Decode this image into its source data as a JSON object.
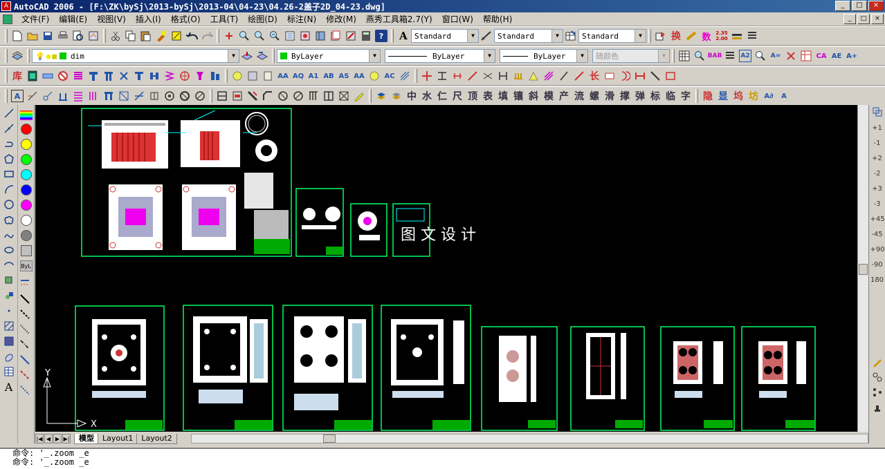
{
  "window": {
    "title": "AutoCAD 2006 - [F:\\ZK\\bySj\\2013-bySj\\2013-04\\04-23\\04.26-2盖子2D_04-23.dwg]",
    "min": "_",
    "max": "□",
    "close": "×"
  },
  "menu": [
    "文件(F)",
    "编辑(E)",
    "视图(V)",
    "插入(I)",
    "格式(O)",
    "工具(T)",
    "绘图(D)",
    "标注(N)",
    "修改(M)",
    "燕秀工具箱2.7(Y)",
    "窗口(W)",
    "帮助(H)"
  ],
  "styles": {
    "text_style": "Standard",
    "dim_style": "Standard",
    "table_style": "Standard"
  },
  "layer": {
    "current": "dim",
    "color": "#00cc00"
  },
  "properties": {
    "color": "ByLayer",
    "linetype": "ByLayer",
    "lineweight": "ByLayer",
    "plotstyle": "随颜色"
  },
  "cjk_tools": [
    "中",
    "水",
    "仁",
    "尺",
    "顶",
    "表",
    "填",
    "镶",
    "斜",
    "模",
    "产",
    "流",
    "螺",
    "滑",
    "撑",
    "弹",
    "标",
    "临",
    "字"
  ],
  "cjk_tools2": [
    "隐",
    "显",
    "坞",
    "坊"
  ],
  "tb3_text": [
    "库",
    "长",
    "换"
  ],
  "left_colors": [
    "#ff0000",
    "#ffff00",
    "#00ff00",
    "#00ffff",
    "#0000ff",
    "#ff00ff",
    "#ffffff",
    "#808080",
    "#c0c0c0"
  ],
  "left_byl": "ByL",
  "right_labels": [
    "+1",
    "-1",
    "+2",
    "-2",
    "+3",
    "-3",
    "+45",
    "-45",
    "+90",
    "-90",
    "180"
  ],
  "canvas": {
    "watermark": "图 文 设 计",
    "ucs_y": "Y",
    "ucs_x": "X",
    "accent": "#00ffff"
  },
  "tabs": [
    "模型",
    "Layout1",
    "Layout2"
  ],
  "command": {
    "line1": "命令:  '_.zoom _e",
    "line2": "命令:  '_.zoom _e"
  }
}
